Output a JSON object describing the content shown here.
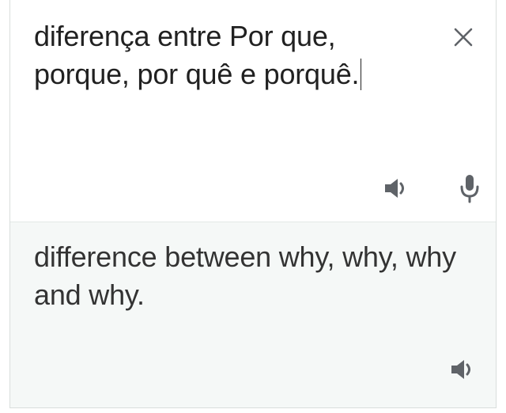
{
  "source": {
    "text": "diferença entre Por que, porque, por quê e porquê."
  },
  "translation": {
    "text": "difference between why, why, why and why."
  },
  "icons": {
    "close": "close-icon",
    "source_speaker": "speaker-icon",
    "microphone": "microphone-icon",
    "target_speaker": "speaker-icon"
  },
  "colors": {
    "text": "#212121",
    "translation_text": "#333333",
    "icon": "#5f6368",
    "translation_background": "#f5f8f7"
  }
}
